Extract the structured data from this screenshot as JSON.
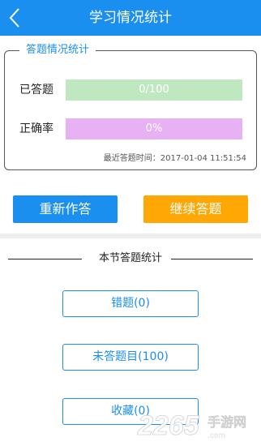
{
  "header": {
    "title": "学习情况统计",
    "back_icon": "chevron-left-icon"
  },
  "stats": {
    "legend": "答题情况统计",
    "answered_label": "已答题",
    "answered_value": "0/100",
    "accuracy_label": "正确率",
    "accuracy_value": "0%",
    "time_label": "最近答题时间：2017-01-04 11:51:54"
  },
  "actions": {
    "redo_label": "重新作答",
    "continue_label": "继续答题"
  },
  "section": {
    "title": "本节答题统计",
    "wrong_label": "错题(0)",
    "unanswered_label": "未答题目(100)",
    "favorites_label": "收藏(0)"
  },
  "colors": {
    "primary": "#1b8ff0",
    "accent": "#ffa805",
    "answered_bar": "#bfe8c0",
    "accuracy_bar": "#e8b1f3"
  }
}
